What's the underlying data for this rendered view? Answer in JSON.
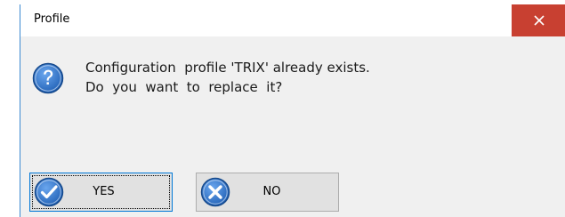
{
  "window": {
    "title": "Profile"
  },
  "message": {
    "line1": "Configuration  profile 'TRIX' already exists.",
    "line2": "Do  you  want  to  replace  it?"
  },
  "buttons": {
    "yes_label": "YES",
    "no_label": "NO"
  },
  "icons": {
    "question": "question-icon",
    "yes": "checkmark-icon",
    "no": "cross-icon",
    "close": "close-icon"
  },
  "colors": {
    "close_button": "#c84031",
    "icon_blue": "#2b6fc2",
    "dialog_background": "#f0f0f0"
  }
}
